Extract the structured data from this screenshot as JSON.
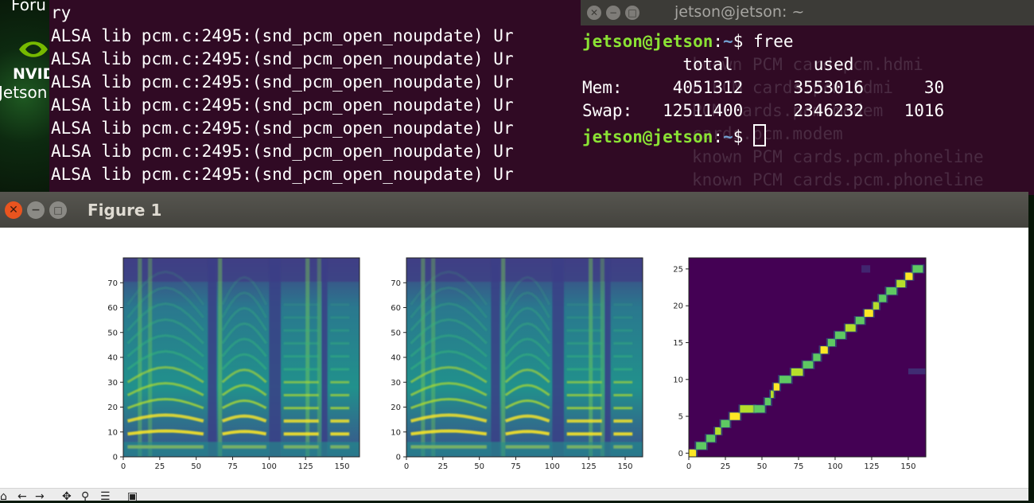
{
  "desktop": {
    "label_top": "Foru",
    "label_nvidia": "NVID",
    "label_jetson": "Jetson"
  },
  "terminal_back": {
    "lines": [
      "ry",
      "ALSA lib pcm.c:2495:(snd_pcm_open_noupdate) Ur",
      "ALSA lib pcm.c:2495:(snd_pcm_open_noupdate) Ur",
      "ALSA lib pcm.c:2495:(snd_pcm_open_noupdate) Ur",
      "ALSA lib pcm.c:2495:(snd_pcm_open_noupdate) Ur",
      "ALSA lib pcm.c:2495:(snd_pcm_open_noupdate) Ur",
      "ALSA lib pcm.c:2495:(snd_pcm_open_noupdate) Ur",
      "ALSA lib pcm.c:2495:(snd_pcm_open_noupdate) Ur"
    ]
  },
  "terminal_front": {
    "title": "jetson@jetson: ~",
    "prompt_user": "jetson@jetson",
    "prompt_sep": ":",
    "prompt_path": "~",
    "prompt_dollar": "$ ",
    "command": "free",
    "header": "          total        used",
    "mem_row": "Mem:     4051312     3553016      30",
    "swap_row": "Swap:   12511400     2346232    1016",
    "ghost_lines": [
      "known PCM card.pcm.hdmi",
      "n PCM cards.pcm.hdmi",
      "PCM cards.pcm.modem",
      "cards.pcm.modem",
      "known PCM cards.pcm.phoneline",
      "known PCM cards.pcm.phoneline"
    ]
  },
  "figure": {
    "title": "Figure 1",
    "close_glyph": "✕",
    "minimize_glyph": "−",
    "maximize_glyph": "□"
  },
  "toolbar": {
    "home_icon": "⌂",
    "back_icon": "←",
    "forward_icon": "→",
    "pan_icon": "✥",
    "zoom_icon": "⚲",
    "config_icon": "☰",
    "save_icon": "▣"
  },
  "chart_data": [
    {
      "type": "heatmap",
      "colormap": "viridis",
      "x_ticks": [
        "0",
        "25",
        "50",
        "75",
        "100",
        "125",
        "150"
      ],
      "y_ticks": [
        "0",
        "10",
        "20",
        "30",
        "40",
        "50",
        "60",
        "70"
      ],
      "xlim": [
        0,
        162
      ],
      "ylim": [
        0,
        80
      ]
    },
    {
      "type": "heatmap",
      "colormap": "viridis",
      "x_ticks": [
        "0",
        "25",
        "50",
        "75",
        "100",
        "125",
        "150"
      ],
      "y_ticks": [
        "0",
        "10",
        "20",
        "30",
        "40",
        "50",
        "60",
        "70"
      ],
      "xlim": [
        0,
        162
      ],
      "ylim": [
        0,
        80
      ]
    },
    {
      "type": "heatmap",
      "colormap": "viridis",
      "x_ticks": [
        "0",
        "25",
        "50",
        "75",
        "100",
        "125",
        "150"
      ],
      "y_ticks": [
        "0",
        "5",
        "10",
        "15",
        "20",
        "25"
      ],
      "xlim": [
        0,
        162
      ],
      "ylim": [
        -0.5,
        26.5
      ],
      "alignment": [
        [
          0,
          0
        ],
        [
          5,
          1
        ],
        [
          12,
          2
        ],
        [
          18,
          3
        ],
        [
          22,
          4
        ],
        [
          28,
          5
        ],
        [
          35,
          6
        ],
        [
          45,
          6
        ],
        [
          52,
          7
        ],
        [
          56,
          8
        ],
        [
          58,
          9
        ],
        [
          62,
          10
        ],
        [
          70,
          11
        ],
        [
          78,
          12
        ],
        [
          85,
          13
        ],
        [
          90,
          14
        ],
        [
          95,
          15
        ],
        [
          100,
          16
        ],
        [
          107,
          17
        ],
        [
          114,
          18
        ],
        [
          120,
          19
        ],
        [
          126,
          20
        ],
        [
          130,
          21
        ],
        [
          135,
          22
        ],
        [
          142,
          23
        ],
        [
          148,
          24
        ],
        [
          153,
          25
        ],
        [
          160,
          26
        ]
      ]
    }
  ]
}
